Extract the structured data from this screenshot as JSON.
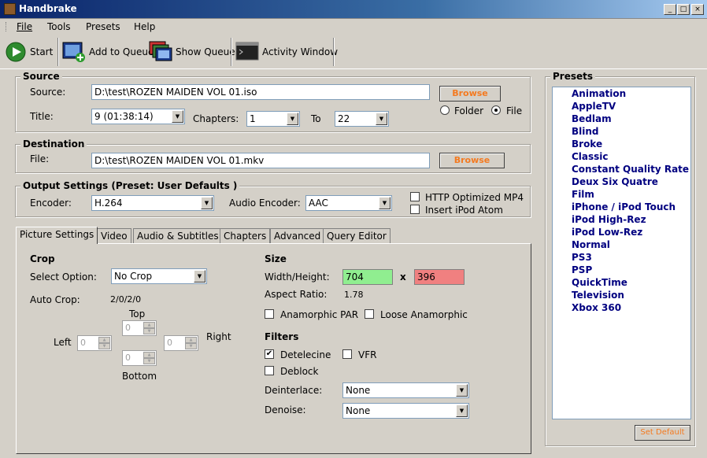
{
  "window": {
    "title": "Handbrake",
    "minimize": "_",
    "maximize": "□",
    "close": "×"
  },
  "menu": {
    "items": [
      "File",
      "Tools",
      "Presets",
      "Help"
    ]
  },
  "toolbar": {
    "start": "Start",
    "add_queue": "Add to Queue",
    "show_queue": "Show Queue",
    "activity": "Activity Window"
  },
  "source": {
    "legend": "Source",
    "source_label": "Source:",
    "source_value": "D:\\test\\ROZEN MAIDEN VOL 01.iso",
    "browse": "Browse",
    "title_label": "Title:",
    "title_value": "9 (01:38:14)",
    "chapters_label": "Chapters:",
    "chapter_from": "1",
    "to_label": "To",
    "chapter_to": "22",
    "folder_label": "Folder",
    "file_label": "File"
  },
  "destination": {
    "legend": "Destination",
    "file_label": "File:",
    "file_value": "D:\\test\\ROZEN MAIDEN VOL 01.mkv",
    "browse": "Browse"
  },
  "output": {
    "legend": "Output Settings (Preset: User Defaults )",
    "encoder_label": "Encoder:",
    "encoder_value": "H.264",
    "audio_label": "Audio Encoder:",
    "audio_value": "AAC",
    "http_label": "HTTP Optimized MP4",
    "ipod_label": "Insert iPod Atom"
  },
  "tabs": [
    "Picture Settings",
    "Video",
    "Audio & Subtitles",
    "Chapters",
    "Advanced",
    "Query Editor"
  ],
  "crop": {
    "heading": "Crop",
    "select_label": "Select Option:",
    "select_value": "No Crop",
    "auto_label": "Auto Crop:",
    "auto_value": "2/0/2/0",
    "top": "Top",
    "bottom": "Bottom",
    "left": "Left",
    "right": "Right",
    "top_val": "0",
    "bottom_val": "0",
    "left_val": "0",
    "right_val": "0"
  },
  "size": {
    "heading": "Size",
    "wh_label": "Width/Height:",
    "width": "704",
    "x": "x",
    "height": "396",
    "aspect_label": "Aspect Ratio:",
    "aspect_value": "1.78",
    "anamorphic": "Anamorphic PAR",
    "loose": "Loose Anamorphic",
    "width_color": "#90ee90",
    "height_color": "#f08080"
  },
  "filters": {
    "heading": "Filters",
    "detelecine": "Detelecine",
    "vfr": "VFR",
    "deblock": "Deblock",
    "deinterlace_label": "Deinterlace:",
    "deinterlace_value": "None",
    "denoise_label": "Denoise:",
    "denoise_value": "None",
    "check_mark": "✔"
  },
  "presets": {
    "legend": "Presets",
    "items": [
      "Animation",
      "AppleTV",
      "Bedlam",
      "Blind",
      "Broke",
      "Classic",
      "Constant Quality Rate",
      "Deux Six Quatre",
      "Film",
      "iPhone / iPod Touch",
      "iPod High-Rez",
      "iPod Low-Rez",
      "Normal",
      "PS3",
      "PSP",
      "QuickTime",
      "Television",
      "Xbox 360"
    ],
    "set_default": "Set Default"
  }
}
